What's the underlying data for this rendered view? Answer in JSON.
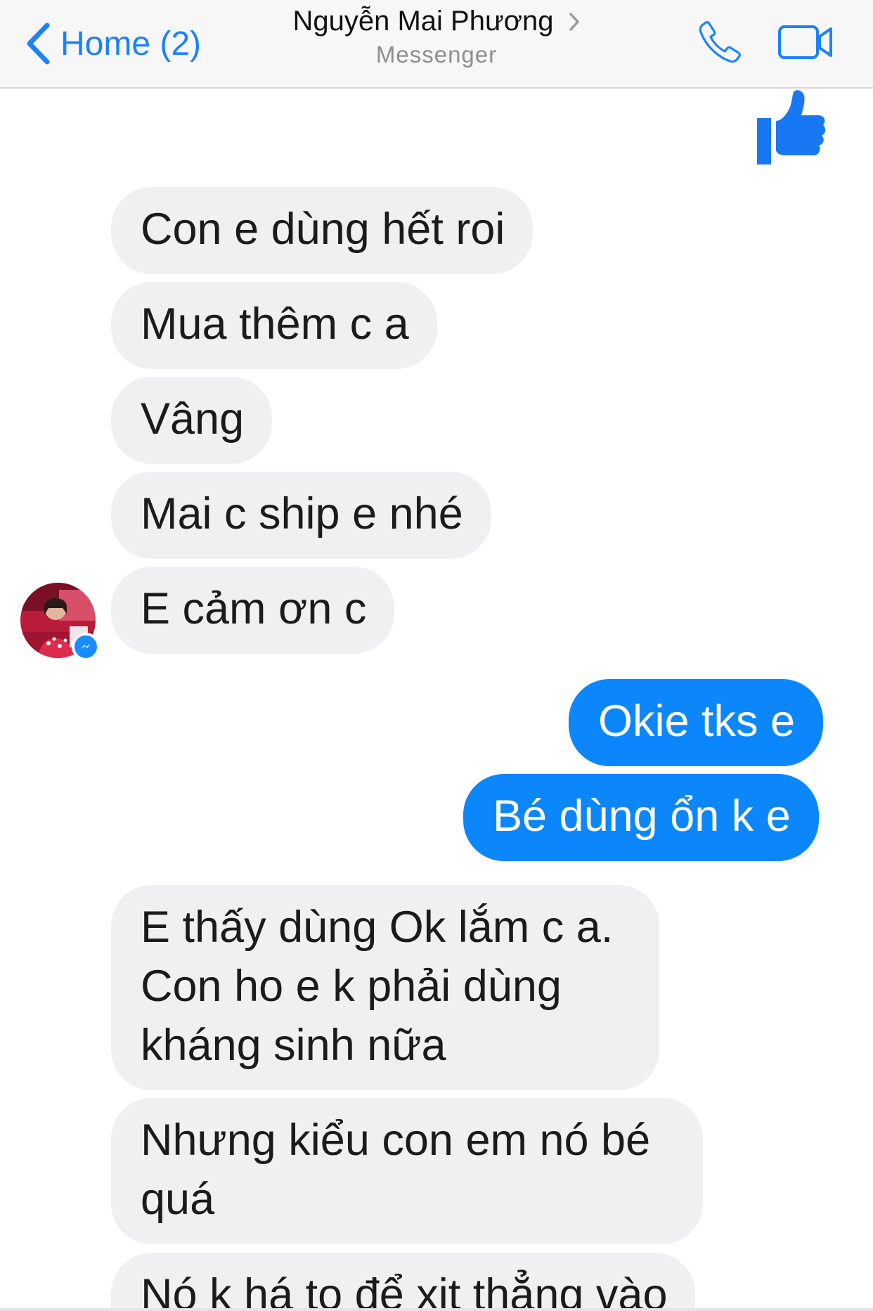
{
  "header": {
    "back_label": "Home (2)",
    "title": "Nguyễn Mai Phương",
    "subtitle": "Messenger"
  },
  "icons": {
    "back": "chevron-left-icon",
    "title_more": "chevron-right-icon",
    "call": "phone-icon",
    "video": "video-camera-icon",
    "like": "thumbs-up-icon",
    "badge": "messenger-icon"
  },
  "colors": {
    "accent": "#1a82fb",
    "outgoing_bubble": "#0b87fb",
    "incoming_bubble": "#f0f0f2",
    "nav_background": "#f7f7f8"
  },
  "messages": [
    {
      "direction": "in",
      "text": "Con e dùng hết roi"
    },
    {
      "direction": "in",
      "text": "Mua thêm c a"
    },
    {
      "direction": "in",
      "text": "Vâng"
    },
    {
      "direction": "in",
      "text": "Mai c ship e nhé"
    },
    {
      "direction": "in",
      "text": "E cảm ơn c"
    },
    {
      "direction": "out",
      "text": "Okie tks e"
    },
    {
      "direction": "out",
      "text": "Bé dùng ổn k e"
    },
    {
      "direction": "in",
      "text": "E thấy dùng Ok lắm c a. Con ho e k phải dùng kháng sinh nữa"
    },
    {
      "direction": "in",
      "text": "Nhưng kiểu con em nó bé quá"
    },
    {
      "direction": "in",
      "text": "Nó k há to để xịt thẳng vào"
    }
  ]
}
